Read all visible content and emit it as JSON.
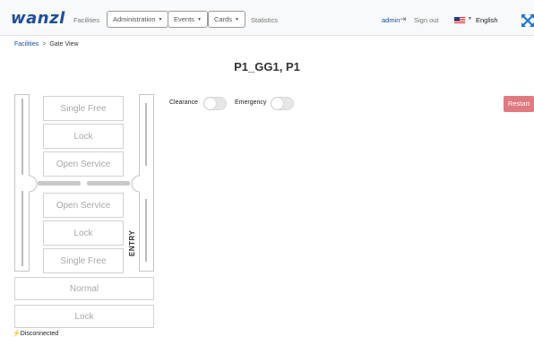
{
  "nav": {
    "logo": "wanzl",
    "facilities": "Facilities",
    "administration": "Administration",
    "events": "Events",
    "cards": "Cards",
    "statistics": "Statistics",
    "user": "admin",
    "sign_out": "Sign out",
    "language": "English",
    "icons": [
      "sign-out-icon",
      "us-flag-icon",
      "fullscreen-icon"
    ]
  },
  "breadcrumb": {
    "root": "Facilities",
    "separator": ">",
    "current": "Gate View"
  },
  "page_title": "P1_GG1, P1",
  "gate": {
    "exit_lane": [
      "Single Free",
      "Lock",
      "Open Service"
    ],
    "entry_lane": [
      "Open Service",
      "Lock",
      "Single Free"
    ],
    "entry_label": "ENTRY",
    "bottom": [
      "Normal",
      "Lock"
    ]
  },
  "controls": {
    "clearance_label": "Clearance",
    "clearance_on": false,
    "emergency_label": "Emergency",
    "emergency_on": false,
    "restart_label": "Restart"
  },
  "colors": {
    "brand": "#1b4fa0",
    "restart": "#e07a80"
  },
  "status": {
    "text": "Disconnected"
  }
}
